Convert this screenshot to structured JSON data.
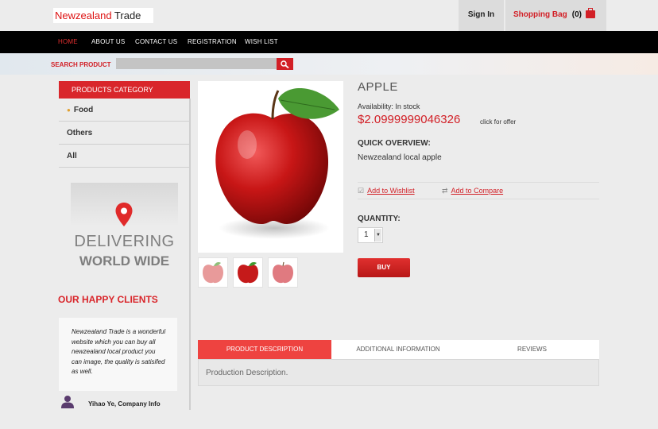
{
  "header": {
    "logo_prefix": "Newzealand",
    "logo_suffix": " Trade",
    "sign_in": "Sign In",
    "bag_label": "Shopping Bag",
    "bag_count": "(0)"
  },
  "nav": {
    "items": [
      "HOME",
      "ABOUT US",
      "CONTACT US",
      "REGISTRATION",
      "WISH LIST"
    ],
    "active": "HOME"
  },
  "search": {
    "label": "SEARCH PRODUCT",
    "value": ""
  },
  "sidebar": {
    "category_title": "PRODUCTS CATEGORY",
    "categories": [
      "Food",
      "Others",
      "All"
    ],
    "banner_line1": "DELIVERING",
    "banner_line2": "WORLD WIDE",
    "happy_title": "OUR HAPPY CLIENTS",
    "testimonial": "Newzealand Trade is a wonderful website which you can buy all newzealand local product you can image, the quality is satisifed as well.",
    "client_name": "Yihao Ye, Company Info"
  },
  "product": {
    "title": "APPLE",
    "availability": "Availability: In stock",
    "price": "$2.0999999046326",
    "offer": "click for offer",
    "overview_title": "QUICK OVERVIEW:",
    "overview_text": "Newzealand local apple",
    "wishlist_label": "Add to Wishlist",
    "compare_label": "Add to Compare",
    "quantity_title": "QUANTITY:",
    "quantity_value": "1",
    "buy_label": "BUY"
  },
  "tabs": {
    "items": [
      "PRODUCT DESCRIPTION",
      "ADDITIONAL INFORMATION",
      "REVIEWS"
    ],
    "active": "PRODUCT DESCRIPTION",
    "content": "Production Description."
  },
  "colors": {
    "accent": "#d21f26",
    "nav_bg": "#000000",
    "page_bg": "#ececec"
  },
  "icons": {
    "bag": "shopping-bag-icon",
    "search": "search-icon",
    "pin": "location-pin-icon",
    "wishlist": "checkbox-icon",
    "compare": "compare-icon",
    "client": "person-icon"
  }
}
